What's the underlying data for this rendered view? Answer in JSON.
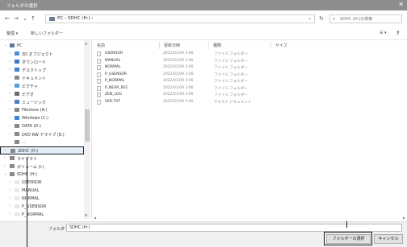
{
  "window": {
    "title": "フォルダの選択",
    "close_glyph": "✕"
  },
  "nav": {
    "back": "←",
    "forward": "→",
    "recent": "⌄",
    "up": "↑",
    "refresh": "↻"
  },
  "address": {
    "crumb": "PC  ›  SDHC (H:)  ›",
    "dropdown": "⌄"
  },
  "search": {
    "placeholder": "SDHC (H:)の検索"
  },
  "toolbar": {
    "organize": "整理 ▾",
    "new_folder": "新しいフォルダー",
    "view": "☰ ▾",
    "help": "?"
  },
  "sidebar": {
    "items": [
      {
        "label": "PC",
        "chevron": "⌄",
        "icon_color": "#5d7a99"
      },
      {
        "label": "3D オブジェクト",
        "chevron": "›",
        "icon_color": "#4f8fd6"
      },
      {
        "label": "ダウンロード",
        "chevron": "›",
        "icon_color": "#3c78c8"
      },
      {
        "label": "デスクトップ",
        "chevron": "›",
        "icon_color": "#3f7fcf"
      },
      {
        "label": "ドキュメント",
        "chevron": "›",
        "icon_color": "#8a8a8a"
      },
      {
        "label": "ピクチャ",
        "chevron": "›",
        "icon_color": "#5aa0d8"
      },
      {
        "label": "ビデオ",
        "chevron": "›",
        "icon_color": "#6b6b6b"
      },
      {
        "label": "ミュージック",
        "chevron": "›",
        "icon_color": "#4b7ec4"
      },
      {
        "label": "Filestore (A:)",
        "chevron": "›",
        "icon_color": "#888888"
      },
      {
        "label": "Windows (C:)",
        "chevron": "›",
        "icon_color": "#3a86d4"
      },
      {
        "label": "DATA (D:)",
        "chevron": "›",
        "icon_color": "#888888"
      },
      {
        "label": "DVD RW ドライブ (E:)",
        "chevron": "›",
        "icon_color": "#888888"
      },
      {
        "label": "...",
        "chevron": "",
        "icon_color": "#888888"
      },
      {
        "label": "SDHC (H:)",
        "chevron": "›",
        "icon_color": "#888888"
      },
      {
        "label": "ライブラリ",
        "chevron": "›",
        "icon_color": "#888888"
      },
      {
        "label": "ボリューム (I:)",
        "chevron": "›",
        "icon_color": "#888888"
      },
      {
        "label": "SDHC (H:)",
        "chevron": "⌄",
        "icon_color": "#888888"
      },
      {
        "label": "GSENSOR",
        "chevron": "›",
        "icon_color": "#e8e8e8"
      },
      {
        "label": "MANUAL",
        "chevron": "›",
        "icon_color": "#e8e8e8"
      },
      {
        "label": "NORMAL",
        "chevron": "›",
        "icon_color": "#e8e8e8"
      },
      {
        "label": "P_GSENSOR",
        "chevron": "›",
        "icon_color": "#e8e8e8"
      },
      {
        "label": "P_NORMAL",
        "chevron": "›",
        "icon_color": "#e8e8e8"
      }
    ]
  },
  "columns": {
    "name": "名前",
    "date": "更新日時",
    "type": "種類",
    "size": "サイズ"
  },
  "files": [
    {
      "name": "GSENSOR",
      "date": "2022/01/09 3:06",
      "type": "ファイル フォルダー"
    },
    {
      "name": "MANUAL",
      "date": "2022/01/09 3:06",
      "type": "ファイル フォルダー"
    },
    {
      "name": "NORMAL",
      "date": "2022/01/09 3:06",
      "type": "ファイル フォルダー"
    },
    {
      "name": "P_GSENSOR",
      "date": "2022/01/09 3:06",
      "type": "ファイル フォルダー"
    },
    {
      "name": "P_NORMAL",
      "date": "2022/01/09 3:06",
      "type": "ファイル フォルダー"
    },
    {
      "name": "P_NEAR_REC",
      "date": "2022/01/09 3:06",
      "type": "ファイル フォルダー"
    },
    {
      "name": "ZEN_LOG",
      "date": "2022/01/09 3:06",
      "type": "ファイル フォルダー"
    },
    {
      "name": "VER.TXT",
      "date": "2022/01/09 3:06",
      "type": "テキスト ドキュメント"
    }
  ],
  "footer": {
    "folder_label": "フォルダー:",
    "folder_value": "SDHC (H:)",
    "select_button": "フォルダーの選択",
    "cancel_button": "キャンセル"
  }
}
